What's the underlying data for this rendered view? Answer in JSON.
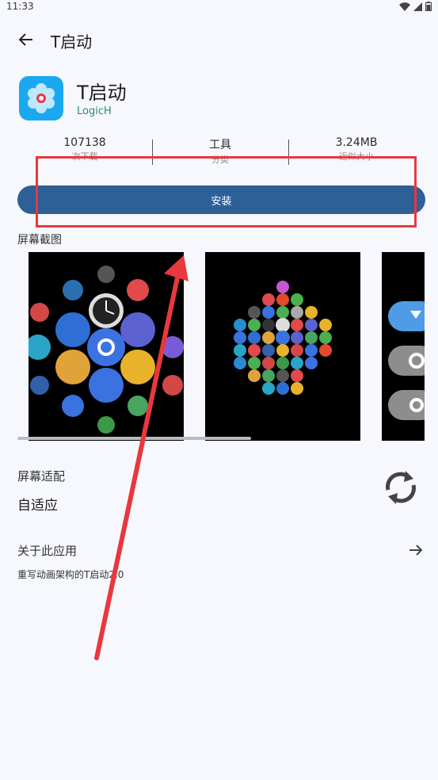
{
  "status_bar": {
    "time": "11:33"
  },
  "header": {
    "title": "T启动"
  },
  "app": {
    "name": "T启动",
    "developer": "LogicH"
  },
  "stats": [
    {
      "value": "107138",
      "label": "次下载"
    },
    {
      "value": "工具",
      "label": "分类"
    },
    {
      "value": "3.24MB",
      "label": "近似大小"
    }
  ],
  "install": {
    "label": "安装"
  },
  "screenshots": {
    "title": "屏幕截图"
  },
  "adaptation": {
    "label": "屏幕适配",
    "value": "自适应"
  },
  "about": {
    "label": "关于此应用",
    "description": "重写动画架构的T启动2.0"
  },
  "colors": {
    "accent": "#2e6098",
    "developer": "#2e8a6e",
    "highlight": "#e8383d",
    "background": "#f6f8fd"
  }
}
